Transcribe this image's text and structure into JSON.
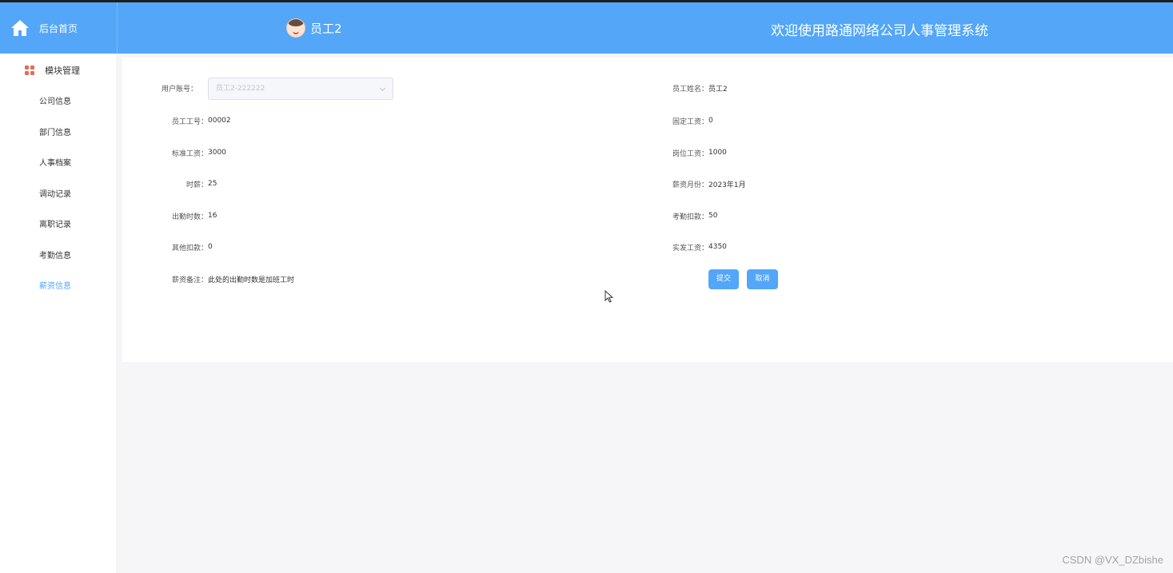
{
  "header": {
    "home_label": "后台首页",
    "user_name": "员工2",
    "welcome": "欢迎使用路通网络公司人事管理系统"
  },
  "sidebar": {
    "group_label": "模块管理",
    "items": [
      {
        "label": "公司信息"
      },
      {
        "label": "部门信息"
      },
      {
        "label": "人事档案"
      },
      {
        "label": "调动记录"
      },
      {
        "label": "离职记录"
      },
      {
        "label": "考勤信息"
      },
      {
        "label": "薪资信息",
        "active": true
      }
    ]
  },
  "form": {
    "user_account": {
      "label": "用户账号：",
      "value": "员工2-222222"
    },
    "employee_name": {
      "label": "员工姓名：",
      "value": "员工2"
    },
    "employee_id": {
      "label": "员工工号：",
      "value": "00002"
    },
    "fixed_salary": {
      "label": "固定工资：",
      "value": "0"
    },
    "standard_salary": {
      "label": "标准工资：",
      "value": "3000"
    },
    "post_salary": {
      "label": "岗位工资：",
      "value": "1000"
    },
    "hourly_wage": {
      "label": "时薪：",
      "value": "25"
    },
    "salary_month": {
      "label": "薪资月份：",
      "value": "2023年1月"
    },
    "attendance_hours": {
      "label": "出勤时数：",
      "value": "16"
    },
    "attendance_deduction": {
      "label": "考勤扣款：",
      "value": "50"
    },
    "other_deduction": {
      "label": "其他扣款：",
      "value": "0"
    },
    "actual_salary": {
      "label": "实发工资：",
      "value": "4350"
    },
    "salary_note": {
      "label": "薪资备注：",
      "value": "此处的出勤时数是加班工时"
    },
    "submit_label": "提交",
    "cancel_label": "取消"
  },
  "watermark": "CSDN @VX_DZbishe",
  "colors": {
    "accent": "#53a6f8",
    "icon_red": "#e46d5a",
    "background": "#f6f6f9"
  }
}
